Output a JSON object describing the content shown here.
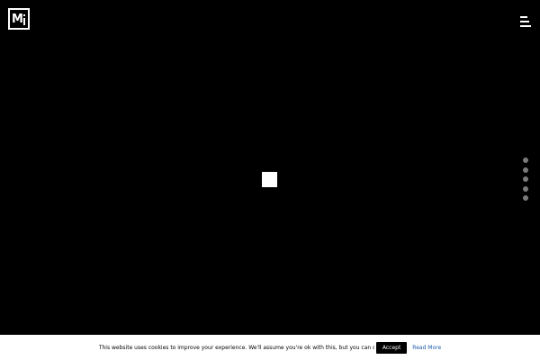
{
  "header": {
    "logo_letter": "M",
    "logo_icon": "brand-logo-mi",
    "menu_icon": "hamburger-menu-icon"
  },
  "loader": {
    "icon": "loading-square"
  },
  "section_nav": {
    "count": 5,
    "dot_color": "#7a7a7a"
  },
  "cookie_bar": {
    "message": "This website uses cookies to improve your experience. We'll assume you're ok with this, but you can opt-out if you wish.",
    "accept_label": "Accept",
    "read_more_label": "Read More"
  },
  "colors": {
    "background": "#000000",
    "foreground": "#ffffff",
    "link": "#1e5aa8"
  }
}
